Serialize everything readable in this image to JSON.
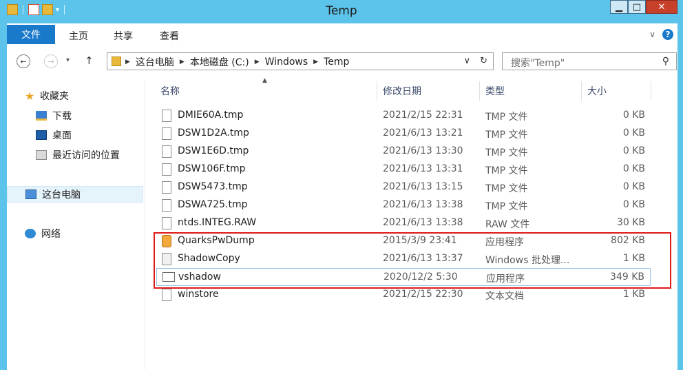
{
  "window": {
    "title": "Temp"
  },
  "ribbon": {
    "tabs": [
      "文件",
      "主页",
      "共享",
      "查看"
    ]
  },
  "address": {
    "crumbs": [
      "这台电脑",
      "本地磁盘 (C:)",
      "Windows",
      "Temp"
    ]
  },
  "search": {
    "placeholder": "搜索\"Temp\""
  },
  "sidebar": {
    "items": [
      {
        "label": "收藏夹",
        "icon": "star-icon"
      },
      {
        "label": "下载",
        "icon": "downloads-folder-icon"
      },
      {
        "label": "桌面",
        "icon": "desktop-icon"
      },
      {
        "label": "最近访问的位置",
        "icon": "recent-places-icon"
      },
      {
        "label": "这台电脑",
        "icon": "computer-icon"
      },
      {
        "label": "网络",
        "icon": "network-icon"
      }
    ]
  },
  "columns": {
    "name": "名称",
    "date": "修改日期",
    "type": "类型",
    "size": "大小"
  },
  "files": [
    {
      "name": "DMIE60A.tmp",
      "date": "2021/2/15 22:31",
      "type": "TMP 文件",
      "size": "0 KB",
      "icon": "file-icon"
    },
    {
      "name": "DSW1D2A.tmp",
      "date": "2021/6/13 13:21",
      "type": "TMP 文件",
      "size": "0 KB",
      "icon": "file-icon"
    },
    {
      "name": "DSW1E6D.tmp",
      "date": "2021/6/13 13:30",
      "type": "TMP 文件",
      "size": "0 KB",
      "icon": "file-icon"
    },
    {
      "name": "DSW106F.tmp",
      "date": "2021/6/13 13:31",
      "type": "TMP 文件",
      "size": "0 KB",
      "icon": "file-icon"
    },
    {
      "name": "DSW5473.tmp",
      "date": "2021/6/13 13:15",
      "type": "TMP 文件",
      "size": "0 KB",
      "icon": "file-icon"
    },
    {
      "name": "DSWA725.tmp",
      "date": "2021/6/13 13:38",
      "type": "TMP 文件",
      "size": "0 KB",
      "icon": "file-icon"
    },
    {
      "name": "ntds.INTEG.RAW",
      "date": "2021/6/13 13:38",
      "type": "RAW 文件",
      "size": "30 KB",
      "icon": "file-icon"
    },
    {
      "name": "QuarksPwDump",
      "date": "2015/3/9 23:41",
      "type": "应用程序",
      "size": "802 KB",
      "icon": "application-icon"
    },
    {
      "name": "ShadowCopy",
      "date": "2021/6/13 13:37",
      "type": "Windows 批处理...",
      "size": "1 KB",
      "icon": "batch-file-icon"
    },
    {
      "name": "vshadow",
      "date": "2020/12/2 5:30",
      "type": "应用程序",
      "size": "349 KB",
      "icon": "application-icon"
    },
    {
      "name": "winstore",
      "date": "2021/2/15 22:30",
      "type": "文本文档",
      "size": "1 KB",
      "icon": "text-file-icon"
    }
  ],
  "colors": {
    "titlebar": "#5cc3ea",
    "file_tab": "#1979ca",
    "highlight_box": "#e01818"
  }
}
